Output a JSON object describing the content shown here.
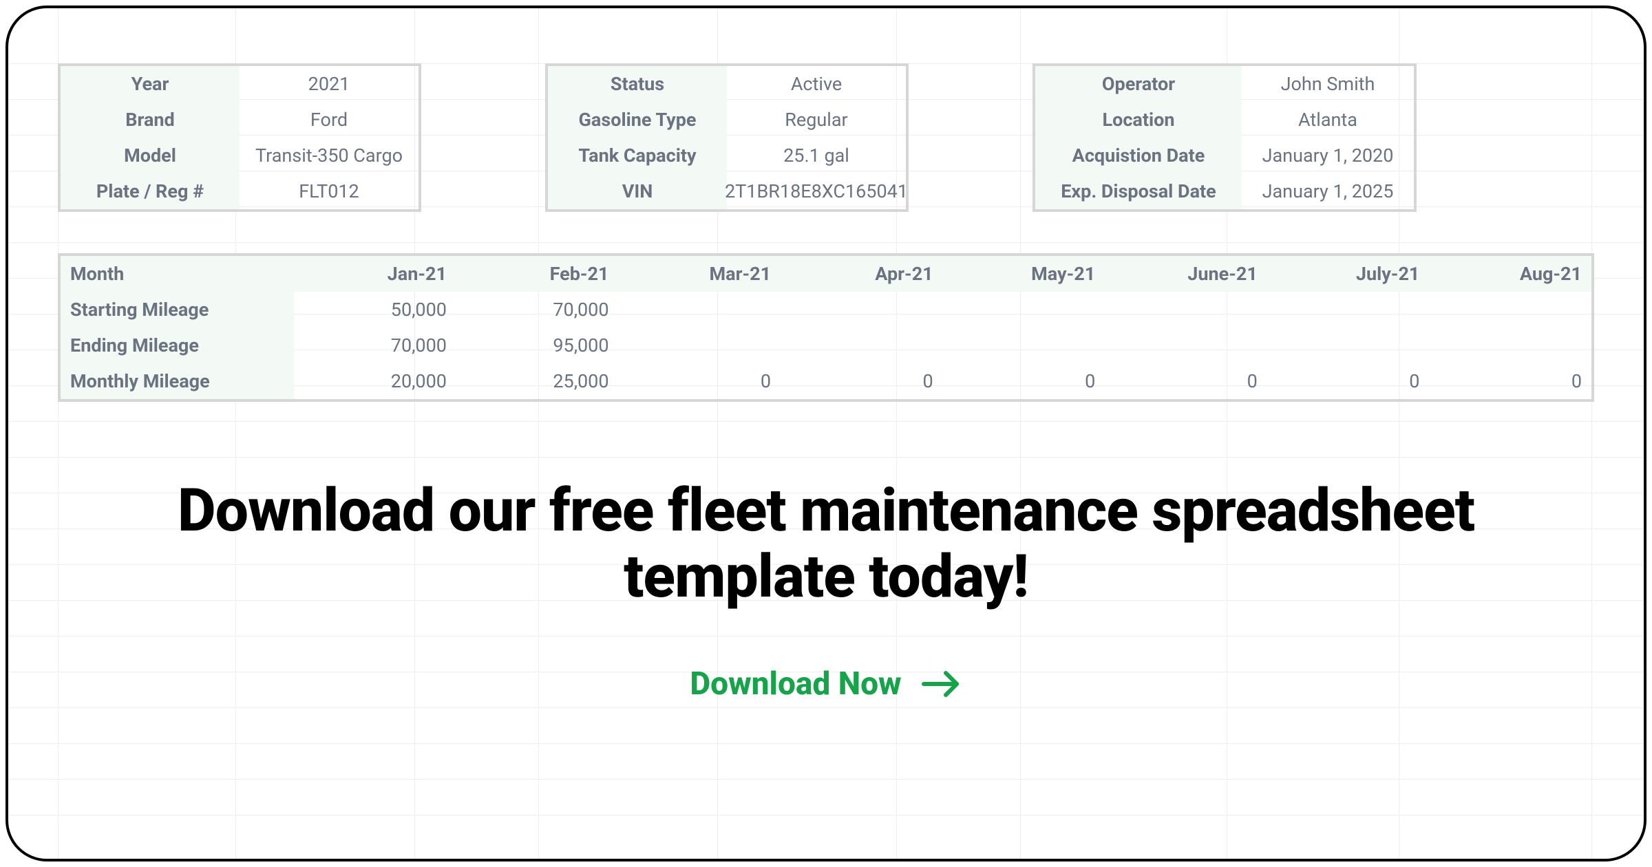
{
  "info_blocks": [
    {
      "labels": [
        "Year",
        "Brand",
        "Model",
        "Plate / Reg #"
      ],
      "values": [
        "2021",
        "Ford",
        "Transit-350 Cargo",
        "FLT012"
      ]
    },
    {
      "labels": [
        "Status",
        "Gasoline Type",
        "Tank Capacity",
        "VIN"
      ],
      "values": [
        "Active",
        "Regular",
        "25.1 gal",
        "2T1BR18E8XC165041"
      ]
    },
    {
      "labels": [
        "Operator",
        "Location",
        "Acquistion Date",
        "Exp. Disposal Date"
      ],
      "values": [
        "John Smith",
        "Atlanta",
        "January 1, 2020",
        "January 1, 2025"
      ]
    }
  ],
  "mileage": {
    "header_first": "Month",
    "months": [
      "Jan-21",
      "Feb-21",
      "Mar-21",
      "Apr-21",
      "May-21",
      "June-21",
      "July-21",
      "Aug-21"
    ],
    "rows": [
      {
        "label": "Starting Mileage",
        "values": [
          "50,000",
          "70,000",
          "",
          "",
          "",
          "",
          "",
          ""
        ]
      },
      {
        "label": "Ending Mileage",
        "values": [
          "70,000",
          "95,000",
          "",
          "",
          "",
          "",
          "",
          ""
        ]
      },
      {
        "label": "Monthly Mileage",
        "values": [
          "20,000",
          "25,000",
          "0",
          "0",
          "0",
          "0",
          "0",
          "0"
        ]
      }
    ]
  },
  "headline": "Download our free fleet maintenance spreadsheet template today!",
  "cta_label": "Download Now"
}
